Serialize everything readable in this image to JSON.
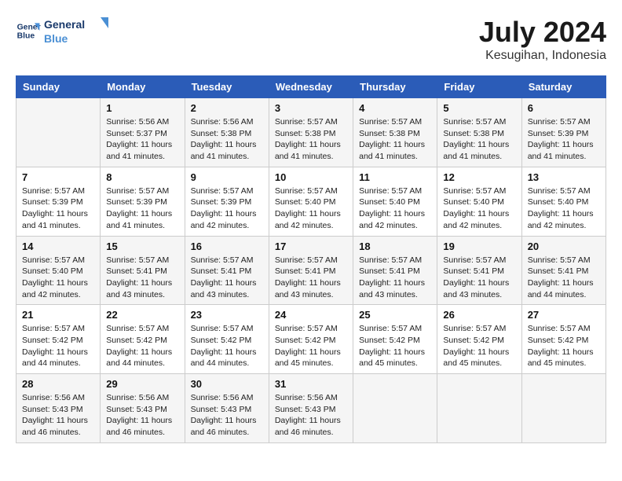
{
  "header": {
    "logo_line1": "General",
    "logo_line2": "Blue",
    "month_title": "July 2024",
    "subtitle": "Kesugihan, Indonesia"
  },
  "weekdays": [
    "Sunday",
    "Monday",
    "Tuesday",
    "Wednesday",
    "Thursday",
    "Friday",
    "Saturday"
  ],
  "weeks": [
    [
      {
        "day": "",
        "info": ""
      },
      {
        "day": "1",
        "info": "Sunrise: 5:56 AM\nSunset: 5:37 PM\nDaylight: 11 hours\nand 41 minutes."
      },
      {
        "day": "2",
        "info": "Sunrise: 5:56 AM\nSunset: 5:38 PM\nDaylight: 11 hours\nand 41 minutes."
      },
      {
        "day": "3",
        "info": "Sunrise: 5:57 AM\nSunset: 5:38 PM\nDaylight: 11 hours\nand 41 minutes."
      },
      {
        "day": "4",
        "info": "Sunrise: 5:57 AM\nSunset: 5:38 PM\nDaylight: 11 hours\nand 41 minutes."
      },
      {
        "day": "5",
        "info": "Sunrise: 5:57 AM\nSunset: 5:38 PM\nDaylight: 11 hours\nand 41 minutes."
      },
      {
        "day": "6",
        "info": "Sunrise: 5:57 AM\nSunset: 5:39 PM\nDaylight: 11 hours\nand 41 minutes."
      }
    ],
    [
      {
        "day": "7",
        "info": "Sunrise: 5:57 AM\nSunset: 5:39 PM\nDaylight: 11 hours\nand 41 minutes."
      },
      {
        "day": "8",
        "info": "Sunrise: 5:57 AM\nSunset: 5:39 PM\nDaylight: 11 hours\nand 41 minutes."
      },
      {
        "day": "9",
        "info": "Sunrise: 5:57 AM\nSunset: 5:39 PM\nDaylight: 11 hours\nand 42 minutes."
      },
      {
        "day": "10",
        "info": "Sunrise: 5:57 AM\nSunset: 5:40 PM\nDaylight: 11 hours\nand 42 minutes."
      },
      {
        "day": "11",
        "info": "Sunrise: 5:57 AM\nSunset: 5:40 PM\nDaylight: 11 hours\nand 42 minutes."
      },
      {
        "day": "12",
        "info": "Sunrise: 5:57 AM\nSunset: 5:40 PM\nDaylight: 11 hours\nand 42 minutes."
      },
      {
        "day": "13",
        "info": "Sunrise: 5:57 AM\nSunset: 5:40 PM\nDaylight: 11 hours\nand 42 minutes."
      }
    ],
    [
      {
        "day": "14",
        "info": "Sunrise: 5:57 AM\nSunset: 5:40 PM\nDaylight: 11 hours\nand 42 minutes."
      },
      {
        "day": "15",
        "info": "Sunrise: 5:57 AM\nSunset: 5:41 PM\nDaylight: 11 hours\nand 43 minutes."
      },
      {
        "day": "16",
        "info": "Sunrise: 5:57 AM\nSunset: 5:41 PM\nDaylight: 11 hours\nand 43 minutes."
      },
      {
        "day": "17",
        "info": "Sunrise: 5:57 AM\nSunset: 5:41 PM\nDaylight: 11 hours\nand 43 minutes."
      },
      {
        "day": "18",
        "info": "Sunrise: 5:57 AM\nSunset: 5:41 PM\nDaylight: 11 hours\nand 43 minutes."
      },
      {
        "day": "19",
        "info": "Sunrise: 5:57 AM\nSunset: 5:41 PM\nDaylight: 11 hours\nand 43 minutes."
      },
      {
        "day": "20",
        "info": "Sunrise: 5:57 AM\nSunset: 5:41 PM\nDaylight: 11 hours\nand 44 minutes."
      }
    ],
    [
      {
        "day": "21",
        "info": "Sunrise: 5:57 AM\nSunset: 5:42 PM\nDaylight: 11 hours\nand 44 minutes."
      },
      {
        "day": "22",
        "info": "Sunrise: 5:57 AM\nSunset: 5:42 PM\nDaylight: 11 hours\nand 44 minutes."
      },
      {
        "day": "23",
        "info": "Sunrise: 5:57 AM\nSunset: 5:42 PM\nDaylight: 11 hours\nand 44 minutes."
      },
      {
        "day": "24",
        "info": "Sunrise: 5:57 AM\nSunset: 5:42 PM\nDaylight: 11 hours\nand 45 minutes."
      },
      {
        "day": "25",
        "info": "Sunrise: 5:57 AM\nSunset: 5:42 PM\nDaylight: 11 hours\nand 45 minutes."
      },
      {
        "day": "26",
        "info": "Sunrise: 5:57 AM\nSunset: 5:42 PM\nDaylight: 11 hours\nand 45 minutes."
      },
      {
        "day": "27",
        "info": "Sunrise: 5:57 AM\nSunset: 5:42 PM\nDaylight: 11 hours\nand 45 minutes."
      }
    ],
    [
      {
        "day": "28",
        "info": "Sunrise: 5:56 AM\nSunset: 5:43 PM\nDaylight: 11 hours\nand 46 minutes."
      },
      {
        "day": "29",
        "info": "Sunrise: 5:56 AM\nSunset: 5:43 PM\nDaylight: 11 hours\nand 46 minutes."
      },
      {
        "day": "30",
        "info": "Sunrise: 5:56 AM\nSunset: 5:43 PM\nDaylight: 11 hours\nand 46 minutes."
      },
      {
        "day": "31",
        "info": "Sunrise: 5:56 AM\nSunset: 5:43 PM\nDaylight: 11 hours\nand 46 minutes."
      },
      {
        "day": "",
        "info": ""
      },
      {
        "day": "",
        "info": ""
      },
      {
        "day": "",
        "info": ""
      }
    ]
  ]
}
